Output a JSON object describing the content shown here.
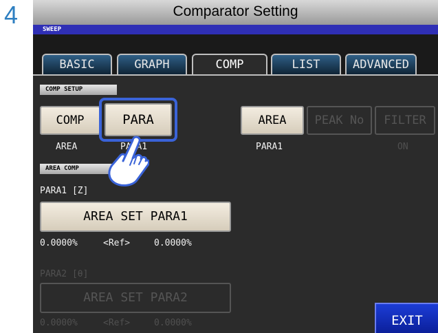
{
  "step_number": "4",
  "window": {
    "title": "Comparator Setting",
    "mode": "SWEEP"
  },
  "tabs": [
    {
      "label": "BASIC",
      "active": false
    },
    {
      "label": "GRAPH",
      "active": false
    },
    {
      "label": "COMP",
      "active": true
    },
    {
      "label": "LIST",
      "active": false
    },
    {
      "label": "ADVANCED",
      "active": false
    }
  ],
  "comp_setup": {
    "section_label": "COMP SETUP",
    "comp_button": "COMP",
    "comp_value": "AREA",
    "para_button": "PARA",
    "para_value": "PARA1",
    "area_button": "AREA",
    "area_value": "PARA1",
    "peak_button": "PEAK No",
    "filter_button": "FILTER",
    "filter_value": "ON"
  },
  "area_comp": {
    "section_label": "AREA COMP",
    "para1": {
      "label": "PARA1 [Z]",
      "button": "AREA SET PARA1",
      "low": "0.0000%",
      "ref": "<Ref>",
      "high": "0.0000%"
    },
    "para2": {
      "label": "PARA2 [θ]",
      "button": "AREA SET PARA2",
      "low": "0.0000%",
      "ref": "<Ref>",
      "high": "0.0000%"
    }
  },
  "exit_button": "EXIT",
  "colors": {
    "accent": "#2f2fb5",
    "selection": "#3a63d8",
    "step_number": "#2e7fc1",
    "exit": "#1c3dd6"
  },
  "icons": {
    "pointer": "pointing-hand-icon"
  }
}
